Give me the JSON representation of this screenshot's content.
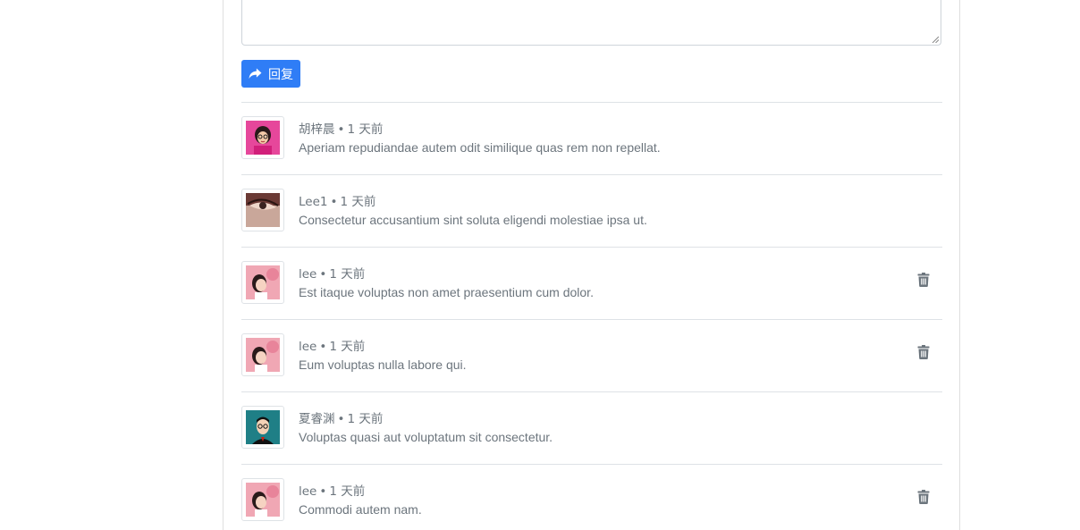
{
  "reply_button": {
    "label": "回复",
    "icon": "share-icon"
  },
  "colors": {
    "primary": "#2f7df6",
    "text_muted": "#6c757d",
    "border": "#dee2e6"
  },
  "comments": [
    {
      "author": "胡梓晨",
      "time": "1 天前",
      "content": "Aperiam repudiandae autem odit similique quas rem non repellat.",
      "avatar": "cartoon-girl-avatar",
      "deletable": false
    },
    {
      "author": "Lee1",
      "time": "1 天前",
      "content": "Consectetur accusantium sint soluta eligendi molestiae ipsa ut.",
      "avatar": "eye-closeup-avatar",
      "deletable": false
    },
    {
      "author": "lee",
      "time": "1 天前",
      "content": "Est itaque voluptas non amet praesentium cum dolor.",
      "avatar": "pink-portrait-avatar",
      "deletable": true
    },
    {
      "author": "lee",
      "time": "1 天前",
      "content": "Eum voluptas nulla labore qui.",
      "avatar": "pink-portrait-avatar",
      "deletable": true
    },
    {
      "author": "夏睿渊",
      "time": "1 天前",
      "content": "Voluptas quasi aut voluptatum sit consectetur.",
      "avatar": "cartoon-man-avatar",
      "deletable": false
    },
    {
      "author": "lee",
      "time": "1 天前",
      "content": "Commodi autem nam.",
      "avatar": "pink-portrait-avatar",
      "deletable": true
    }
  ]
}
